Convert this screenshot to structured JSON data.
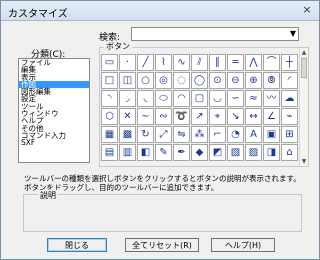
{
  "window": {
    "title": "カスタマイズ",
    "close_label": "×"
  },
  "search": {
    "label": "検索:",
    "value": ""
  },
  "categories": {
    "label": "分類(C):",
    "items": [
      {
        "label": "ファイル",
        "selected": false
      },
      {
        "label": "編集",
        "selected": false
      },
      {
        "label": "表示",
        "selected": false
      },
      {
        "label": "作図",
        "selected": true
      },
      {
        "label": "図形編集",
        "selected": false
      },
      {
        "label": "設定",
        "selected": false
      },
      {
        "label": "ツール",
        "selected": false
      },
      {
        "label": "ウィンドウ",
        "selected": false
      },
      {
        "label": "ヘルプ",
        "selected": false
      },
      {
        "label": "その他",
        "selected": false
      },
      {
        "label": "コマンド入力",
        "selected": false
      },
      {
        "label": "SXF",
        "selected": false
      }
    ]
  },
  "buttons_group": {
    "label": "ボタン",
    "icons": [
      "rectangle-icon",
      "point-icon",
      "line-icon",
      "polyline-icon",
      "freehand-icon",
      "offset-line-icon",
      "parallel-line-icon",
      "double-line-icon",
      "zigzag-line-icon",
      "tangent-line-icon",
      "construction-line-icon",
      "box-icon",
      "diagonal-box-icon",
      "circle-icon",
      "concentric-circle-icon",
      "tangent-circle-icon",
      "ring-icon",
      "circle-3pt-icon",
      "circle-2pt-icon",
      "circle-center-icon",
      "double-circle-icon",
      "arc-icon",
      "arc-3pt-icon",
      "arc-center-icon",
      "arc-tangent-icon",
      "ellipse-icon",
      "ellipse-arc-icon",
      "rounded-box-icon",
      "fillet-icon",
      "curve-icon",
      "spline-icon",
      "wave-icon",
      "cloud-icon",
      "hexagon-icon",
      "cross-icon",
      "wave-line-icon",
      "sine-icon",
      "helix-icon",
      "arrow-line-icon",
      "center-mark-icon",
      "leader-icon",
      "dimension-icon",
      "angle-dim-icon",
      "break-line-icon",
      "hatch-icon",
      "grid-icon",
      "rotate-icon",
      "scale-icon",
      "mirror-icon",
      "array-icon",
      "bracket-icon",
      "bubble-icon",
      "text-icon",
      "callout-icon",
      "stamp-icon",
      "table-icon",
      "frame-icon",
      "chamfer-icon",
      "pencil-icon",
      "pen-icon",
      "marker-icon",
      "box-3d-icon",
      "cube-icon",
      "cylinder-icon",
      "pipe-icon",
      "door-icon"
    ]
  },
  "description": {
    "line1": "ツールバーの種類を選択しボタンをクリックするとボタンの説明が表示されます。",
    "line2": "ボタンをドラッグし、目的のツールバーに追加できます。",
    "label": "説明",
    "text": ""
  },
  "actions": {
    "close_label": "閉じる",
    "reset_all_label": "全てリセット(R)",
    "help_label": "ヘルプ(H)"
  }
}
